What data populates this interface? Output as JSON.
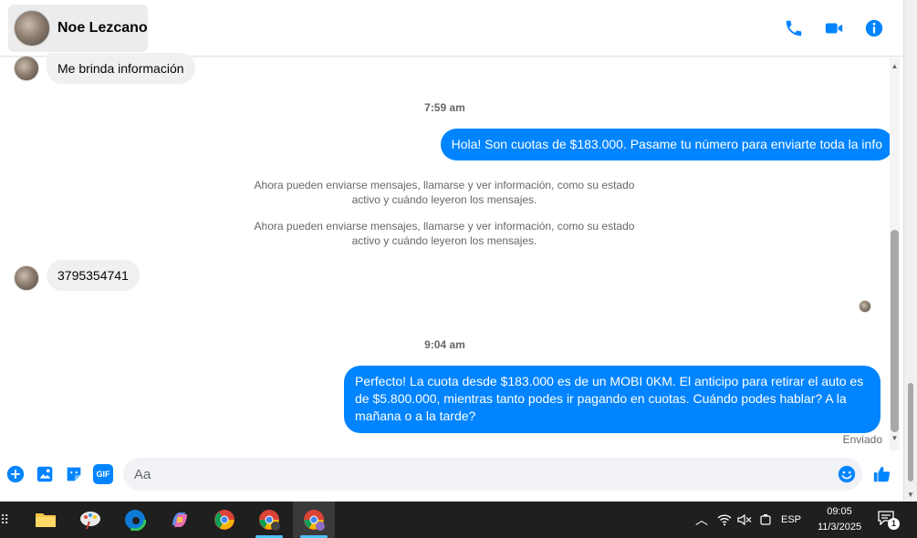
{
  "header": {
    "contact_name": "Noe Lezcano",
    "icons": [
      "phone-icon",
      "video-camera-icon",
      "info-icon"
    ],
    "accent_color": "#0084ff"
  },
  "messages": {
    "incoming_1": "Me brinda información",
    "time_1": "7:59 am",
    "outgoing_1": "Hola! Son cuotas de $183.000. Pasame tu número para enviarte toda la info",
    "system_1": "Ahora pueden enviarse mensajes, llamarse y ver información, como su estado activo y cuándo leyeron los mensajes.",
    "system_2": "Ahora pueden enviarse mensajes, llamarse y ver información, como su estado activo y cuándo leyeron los mensajes.",
    "incoming_2": "3795354741",
    "time_2": "9:04 am",
    "outgoing_2": "Perfecto! La cuota desde $183.000 es de un MOBI 0KM. El anticipo para retirar el auto es de $5.800.000, mientras tanto podes ir pagando en cuotas. Cuándo podes hablar? A la mañana o a la tarde?",
    "status": "Enviado"
  },
  "composer": {
    "placeholder": "Aa",
    "value": "",
    "icons": [
      "plus-icon",
      "image-icon",
      "sticker-icon",
      "gif-icon",
      "emoji-icon",
      "thumbs-up-icon"
    ],
    "gif_label": "GIF"
  },
  "taskbar": {
    "apps": [
      "file-explorer-icon",
      "paint-icon",
      "edge-icon",
      "copilot-icon",
      "chrome-icon",
      "chrome-profile-icon",
      "chrome-profile-active-icon"
    ],
    "language": "ESP",
    "time": "09:05",
    "date": "11/3/2025",
    "notification_count": "1"
  }
}
